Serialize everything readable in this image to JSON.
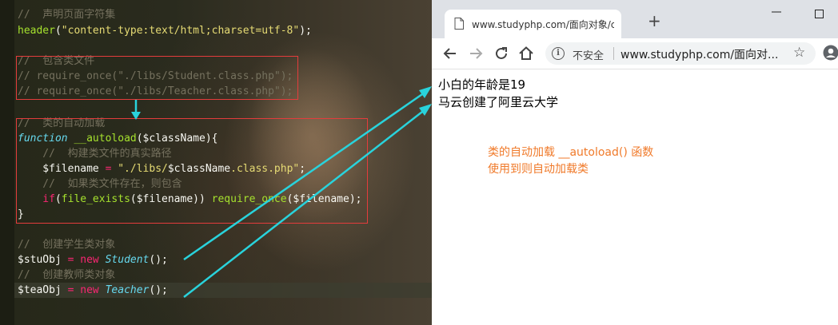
{
  "editor": {
    "lines": [
      {
        "segments": [
          {
            "t": "cm",
            "text": "//  声明页面字符集"
          }
        ]
      },
      {
        "segments": [
          {
            "t": "fn",
            "text": "header"
          },
          {
            "t": "vr",
            "text": "("
          },
          {
            "t": "st",
            "text": "\"content-type:text/html;charset=utf-8\""
          },
          {
            "t": "vr",
            "text": ");"
          }
        ]
      },
      {
        "segments": []
      },
      {
        "segments": [
          {
            "t": "cm",
            "text": "//  包含类文件"
          }
        ]
      },
      {
        "segments": [
          {
            "t": "cm",
            "text": "// require_once(\"./libs/Student.class.php\");"
          }
        ]
      },
      {
        "segments": [
          {
            "t": "cm",
            "text": "// require_once(\"./libs/Teacher.class.php\");"
          }
        ]
      },
      {
        "segments": []
      },
      {
        "segments": [
          {
            "t": "cm",
            "text": "//  类的自动加载"
          }
        ]
      },
      {
        "segments": [
          {
            "t": "df",
            "text": "function"
          },
          {
            "t": "vr",
            "text": " "
          },
          {
            "t": "fn",
            "text": "__autoload"
          },
          {
            "t": "vr",
            "text": "($className){"
          }
        ]
      },
      {
        "segments": [
          {
            "t": "cm",
            "text": "    //  构建类文件的真实路径"
          }
        ]
      },
      {
        "segments": [
          {
            "t": "vr",
            "text": "    $filename "
          },
          {
            "t": "kw",
            "text": "="
          },
          {
            "t": "vr",
            "text": " "
          },
          {
            "t": "st",
            "text": "\"./libs/"
          },
          {
            "t": "vr",
            "text": "$className"
          },
          {
            "t": "st",
            "text": ".class.php\""
          },
          {
            "t": "vr",
            "text": ";"
          }
        ]
      },
      {
        "segments": [
          {
            "t": "cm",
            "text": "    //  如果类文件存在，则包含"
          }
        ]
      },
      {
        "segments": [
          {
            "t": "kw",
            "text": "    if"
          },
          {
            "t": "vr",
            "text": "("
          },
          {
            "t": "fn",
            "text": "file_exists"
          },
          {
            "t": "vr",
            "text": "($filename)) "
          },
          {
            "t": "fn",
            "text": "require_once"
          },
          {
            "t": "vr",
            "text": "($filename);"
          }
        ]
      },
      {
        "segments": [
          {
            "t": "vr",
            "text": "}"
          }
        ]
      },
      {
        "segments": []
      },
      {
        "segments": [
          {
            "t": "cm",
            "text": "//  创建学生类对象"
          }
        ]
      },
      {
        "segments": [
          {
            "t": "vr",
            "text": "$stuObj "
          },
          {
            "t": "kw",
            "text": "="
          },
          {
            "t": "vr",
            "text": " "
          },
          {
            "t": "kw",
            "text": "new"
          },
          {
            "t": "vr",
            "text": " "
          },
          {
            "t": "cl",
            "text": "Student"
          },
          {
            "t": "vr",
            "text": "();"
          }
        ]
      },
      {
        "segments": [
          {
            "t": "cm",
            "text": "//  创建教师类对象"
          }
        ]
      },
      {
        "segments": [
          {
            "t": "vr",
            "text": "$teaObj "
          },
          {
            "t": "kw",
            "text": "="
          },
          {
            "t": "vr",
            "text": " "
          },
          {
            "t": "kw",
            "text": "new"
          },
          {
            "t": "vr",
            "text": " "
          },
          {
            "t": "cl",
            "text": "Teacher"
          },
          {
            "t": "vr",
            "text": "();"
          }
        ]
      }
    ],
    "active_line": 18
  },
  "browser": {
    "tab_title": "www.studyphp.com/面向对象/c",
    "new_tab": "+",
    "insecure_label": "不安全",
    "url": "www.studyphp.com/面向对...",
    "output": [
      "小白的年龄是19",
      "马云创建了阿里云大学"
    ],
    "annotation": [
      "类的自动加载 __autoload() 函数",
      "使用到则自动加载类"
    ]
  },
  "colors": {
    "comment": "#75715e",
    "function": "#a6e22e",
    "string": "#e6db74",
    "keyword": "#f92672",
    "annotation": "#f07a2a",
    "arrow": "#29d3dc",
    "highlight_box": "#e43c3c"
  },
  "icons": [
    "page-icon",
    "minimize-icon",
    "maximize-icon",
    "back-icon",
    "forward-icon",
    "reload-icon",
    "home-icon",
    "info-icon",
    "star-icon",
    "profile-icon"
  ]
}
